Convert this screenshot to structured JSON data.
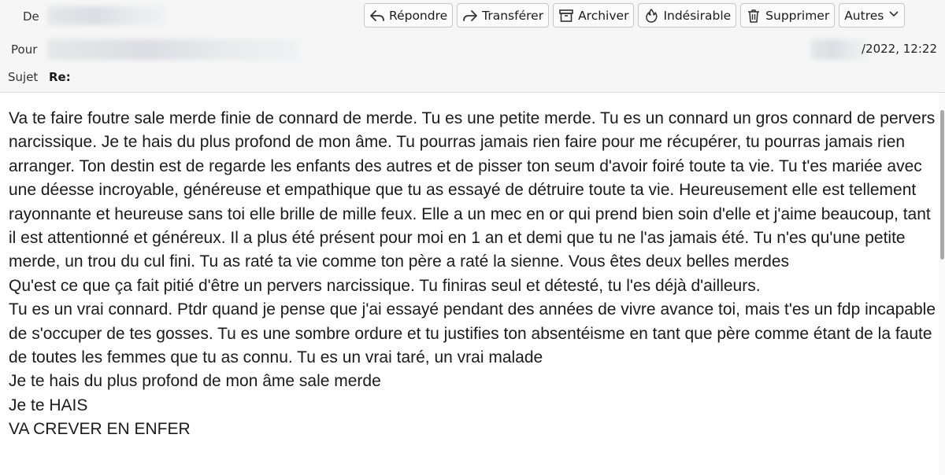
{
  "header": {
    "from_label": "De",
    "to_label": "Pour",
    "subject_label": "Sujet",
    "subject_value": "Re:",
    "date_text": "/2022, 12:22"
  },
  "toolbar": {
    "reply": {
      "label": "Répondre",
      "icon": "reply-icon"
    },
    "forward": {
      "label": "Transférer",
      "icon": "forward-icon"
    },
    "archive": {
      "label": "Archiver",
      "icon": "archive-icon"
    },
    "junk": {
      "label": "Indésirable",
      "icon": "junk-flame-icon"
    },
    "delete": {
      "label": "Supprimer",
      "icon": "trash-icon"
    },
    "more": {
      "label": "Autres",
      "icon": "chevron-down-icon"
    }
  },
  "message": {
    "paragraphs": [
      "Va te faire foutre sale merde finie de connard de merde. Tu es une petite merde. Tu es un connard un gros connard de pervers narcissique. Je te hais du plus profond de mon âme. Tu pourras jamais rien faire pour me récupérer, tu pourras jamais rien arranger. Ton destin est de regarde les enfants des autres et de pisser ton seum d'avoir foiré toute ta vie. Tu t'es mariée avec une déesse incroyable, généreuse et empathique que tu as essayé de détruire toute ta vie. Heureusement elle est tellement rayonnante et heureuse sans toi elle brille de mille feux. Elle a un mec en or qui prend bien soin d'elle et j'aime beaucoup, tant il est attentionné et généreux. Il a plus été présent pour moi en 1 an et demi que tu ne l'as jamais été. Tu n'es qu'une petite merde, un trou du cul fini. Tu as raté ta vie comme ton père a raté la sienne. Vous êtes deux belles merdes",
      "Qu'est ce que ça fait pitié d'être un pervers narcissique. Tu finiras seul et détesté, tu l'es déjà d'ailleurs.",
      "Tu es un vrai connard. Ptdr quand je pense que j'ai essayé pendant des années de vivre avance toi, mais t'es un fdp incapable de s'occuper de tes gosses. Tu es une sombre ordure et tu justifies ton absentéisme en tant que père comme étant de la faute de toutes les femmes que tu as connu. Tu es un vrai taré, un vrai malade",
      "Je te hais du plus profond de mon âme sale merde",
      "Je te HAIS",
      "VA CREVER EN ENFER"
    ]
  }
}
